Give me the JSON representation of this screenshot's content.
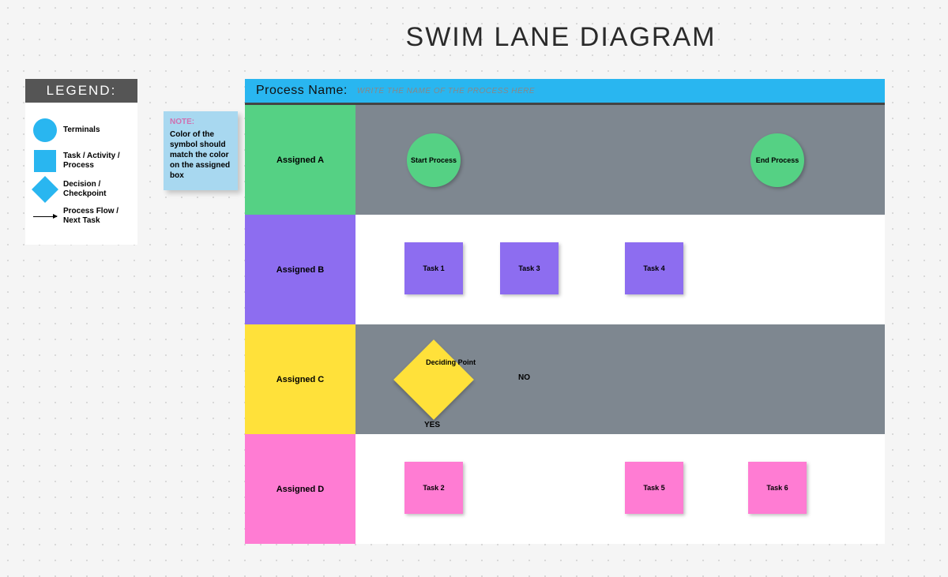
{
  "title": "SWIM LANE DIAGRAM",
  "legend": {
    "header": "LEGEND:",
    "items": [
      {
        "label": "Terminals"
      },
      {
        "label": "Task / Activity / Process"
      },
      {
        "label": "Decision / Checkpoint"
      },
      {
        "label": "Process Flow / Next Task"
      }
    ]
  },
  "note": {
    "head": "NOTE:",
    "body": "Color of the symbol should match the color on the assigned box"
  },
  "header": {
    "label": "Process Name:",
    "placeholder": "WRITE THE NAME OF THE PROCESS HERE"
  },
  "lanes": {
    "A": "Assigned A",
    "B": "Assigned B",
    "C": "Assigned C",
    "D": "Assigned D"
  },
  "nodes": {
    "start": "Start Process",
    "end": "End Process",
    "t1": "Task 1",
    "t2": "Task 2",
    "t3": "Task 3",
    "t4": "Task 4",
    "t5": "Task 5",
    "t6": "Task 6",
    "decide": "Deciding Point",
    "yes": "YES",
    "no": "NO"
  },
  "chart_data": {
    "type": "swimlane",
    "lanes": [
      {
        "id": "A",
        "label": "Assigned A",
        "color": "#55d184"
      },
      {
        "id": "B",
        "label": "Assigned B",
        "color": "#8d6df0"
      },
      {
        "id": "C",
        "label": "Assigned C",
        "color": "#ffe13a"
      },
      {
        "id": "D",
        "label": "Assigned D",
        "color": "#ff7cd3"
      }
    ],
    "nodes": [
      {
        "id": "start",
        "type": "terminal",
        "lane": "A",
        "label": "Start Process"
      },
      {
        "id": "end",
        "type": "terminal",
        "lane": "A",
        "label": "End Process"
      },
      {
        "id": "t1",
        "type": "task",
        "lane": "B",
        "label": "Task 1"
      },
      {
        "id": "t3",
        "type": "task",
        "lane": "B",
        "label": "Task 3"
      },
      {
        "id": "t4",
        "type": "task",
        "lane": "B",
        "label": "Task 4"
      },
      {
        "id": "decide",
        "type": "decision",
        "lane": "C",
        "label": "Deciding Point"
      },
      {
        "id": "t2",
        "type": "task",
        "lane": "D",
        "label": "Task 2"
      },
      {
        "id": "t5",
        "type": "task",
        "lane": "D",
        "label": "Task 5"
      },
      {
        "id": "t6",
        "type": "task",
        "lane": "D",
        "label": "Task 6"
      }
    ],
    "edges": [
      {
        "from": "start",
        "to": "t1"
      },
      {
        "from": "t1",
        "to": "decide"
      },
      {
        "from": "decide",
        "to": "t3",
        "label": "NO"
      },
      {
        "from": "decide",
        "to": "t2",
        "label": "YES"
      },
      {
        "from": "t3",
        "to": "t4"
      },
      {
        "from": "t4",
        "to": "t5"
      },
      {
        "from": "t2",
        "to": "t5"
      },
      {
        "from": "t5",
        "to": "t6"
      },
      {
        "from": "t6",
        "to": "end"
      }
    ]
  }
}
